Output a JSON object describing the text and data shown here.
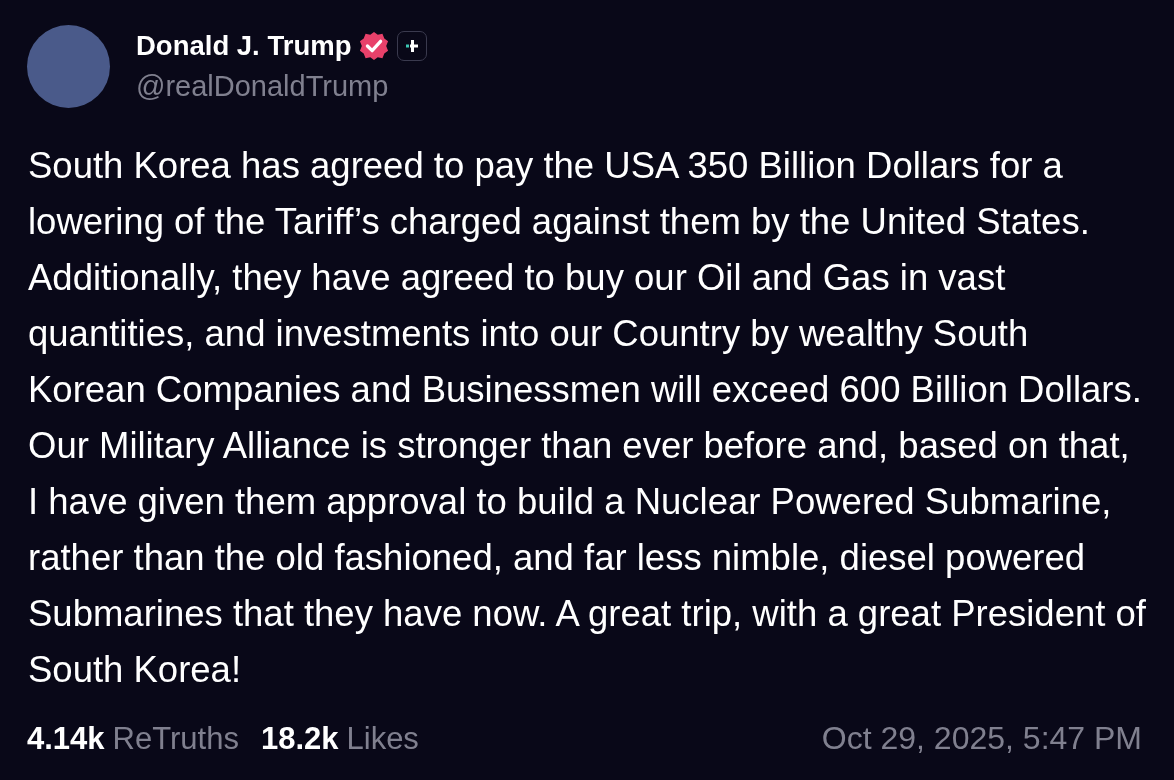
{
  "author": {
    "name": "Donald J. Trump",
    "handle": "@realDonaldTrump",
    "verified": true
  },
  "post": {
    "text": "South Korea has agreed to pay the USA 350 Billion Dollars for a lowering of the Tariff’s charged against them by the United States. Additionally, they have agreed to buy our Oil and Gas in vast quantities, and investments into our Country by wealthy South Korean Companies and Businessmen will exceed 600 Billion Dollars. Our Military Alliance is stronger than ever before and, based on that, I have given them approval to build a Nuclear Powered Submarine, rather than the old fashioned, and far less nimble, diesel powered Submarines that they have now. A great trip, with a great President of South Korea!"
  },
  "stats": [
    {
      "count": "4.14k",
      "label": "ReTruths"
    },
    {
      "count": "18.2k",
      "label": "Likes"
    }
  ],
  "timestamp": "Oct 29, 2025, 5:47 PM"
}
